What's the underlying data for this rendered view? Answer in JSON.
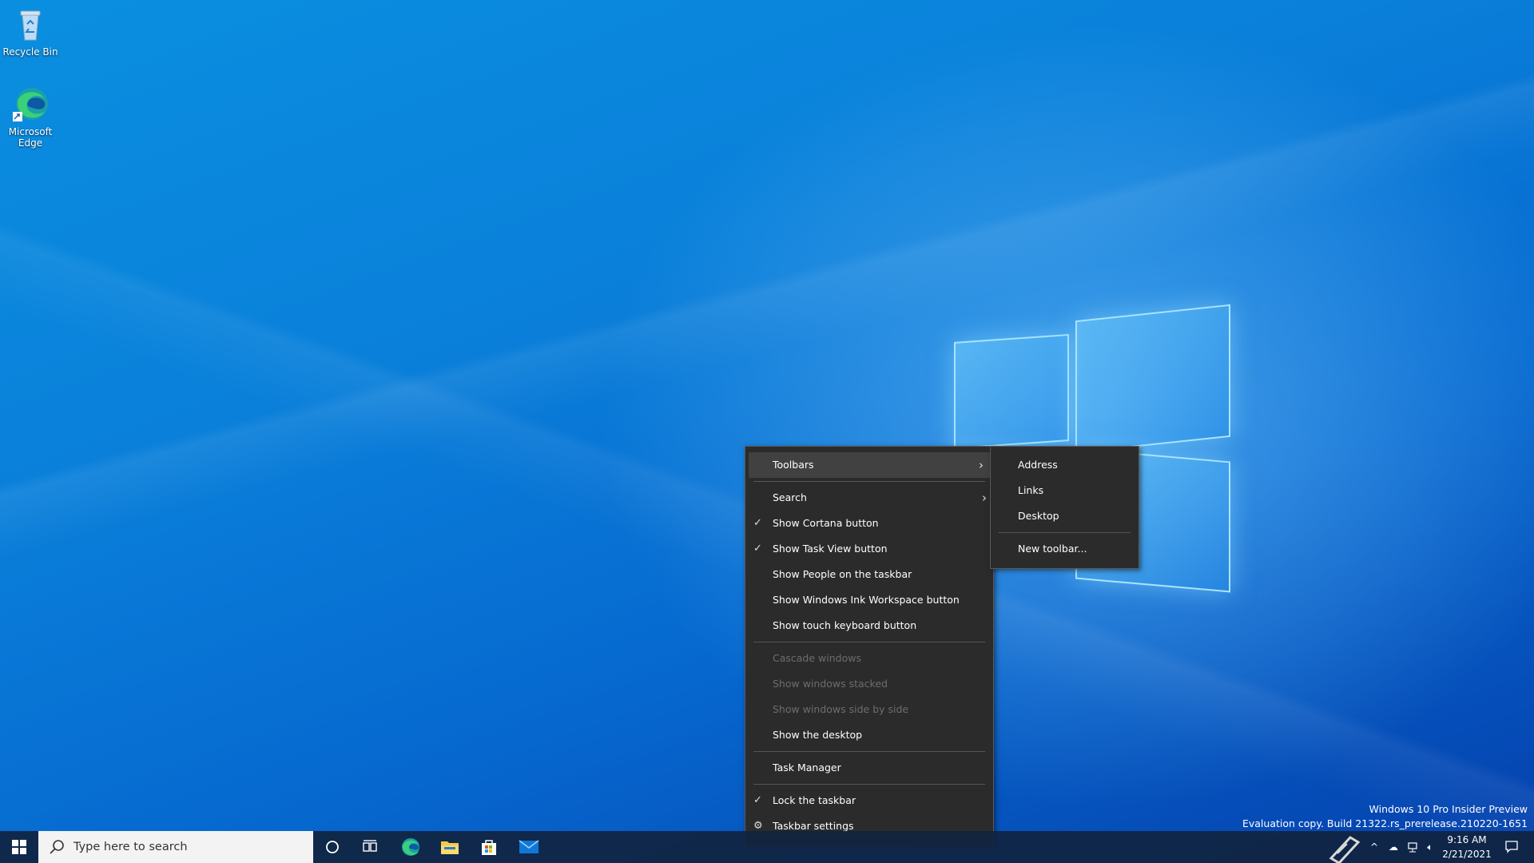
{
  "desktop": {
    "icons": [
      {
        "label": "Recycle Bin"
      },
      {
        "label": "Microsoft Edge"
      }
    ]
  },
  "context_menu": {
    "items": [
      {
        "label": "Toolbars",
        "submenu": true,
        "highlighted": true
      },
      {
        "label": "Search",
        "submenu": true
      },
      {
        "label": "Show Cortana button",
        "checked": true
      },
      {
        "label": "Show Task View button",
        "checked": true
      },
      {
        "label": "Show People on the taskbar"
      },
      {
        "label": "Show Windows Ink Workspace button"
      },
      {
        "label": "Show touch keyboard button"
      },
      {
        "label": "Cascade windows",
        "disabled": true
      },
      {
        "label": "Show windows stacked",
        "disabled": true
      },
      {
        "label": "Show windows side by side",
        "disabled": true
      },
      {
        "label": "Show the desktop"
      },
      {
        "label": "Task Manager"
      },
      {
        "label": "Lock the taskbar",
        "checked": true
      },
      {
        "label": "Taskbar settings",
        "icon": "gear-icon"
      }
    ]
  },
  "toolbars_submenu": {
    "items": [
      {
        "label": "Address"
      },
      {
        "label": "Links"
      },
      {
        "label": "Desktop"
      },
      {
        "label": "New toolbar..."
      }
    ]
  },
  "watermark": {
    "line1": "Windows 10 Pro Insider Preview",
    "line2": "Evaluation copy. Build 21322.rs_prerelease.210220-1651"
  },
  "taskbar": {
    "search_placeholder": "Type here to search",
    "pinned": [
      "cortana-icon",
      "task-view-icon",
      "edge-icon",
      "file-explorer-icon",
      "store-icon",
      "mail-icon"
    ],
    "clock": {
      "time": "9:16 AM",
      "date": "2/21/2021"
    }
  },
  "colors": {
    "menu_bg": "#2b2b2b",
    "menu_highlight": "#414141",
    "desktop_accent": "#0a80da"
  }
}
